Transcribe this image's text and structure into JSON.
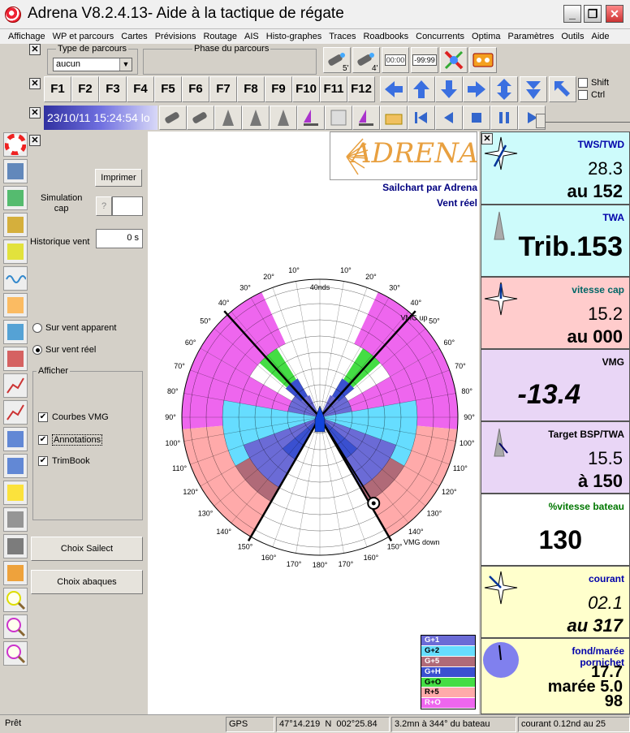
{
  "window": {
    "title": "Adrena V8.2.4.13- Aide à la tactique de régate",
    "minimize": "_",
    "restore": "❐",
    "close": "✕"
  },
  "menu": [
    "Affichage",
    "WP et parcours",
    "Cartes",
    "Prévisions",
    "Routage",
    "AIS",
    "Histo-graphes",
    "Traces",
    "Roadbooks",
    "Concurrents",
    "Optima",
    "Paramètres",
    "Outils",
    "Aide"
  ],
  "toolbar1": {
    "type_parcours_label": "Type de parcours",
    "type_parcours_value": "aucun",
    "phase_label": "Phase du parcours",
    "timer1": "00:00",
    "timer2": "-99:99",
    "btn_5": "5'",
    "btn_4": "4'"
  },
  "toolbar2": {
    "fkeys": [
      "F1",
      "F2",
      "F3",
      "F4",
      "F5",
      "F6",
      "F7",
      "F8",
      "F9",
      "F10",
      "F11",
      "F12"
    ],
    "shift": "Shift",
    "ctrl": "Ctrl"
  },
  "toolbar3": {
    "datetime": "23/10/11 15:24:54 lo"
  },
  "left": {
    "imprimer": "Imprimer",
    "simulation_cap": "Simulation\ncap",
    "question": "?",
    "historique_vent": "Historique vent",
    "historique_value": "0 s",
    "radio1": "Sur vent apparent",
    "radio2": "Sur vent réel",
    "afficher": "Afficher",
    "cb1": "Courbes VMG",
    "cb2": "Annotations",
    "cb3": "TrimBook",
    "choix_sailect": "Choix Sailect",
    "choix_abaques": "Choix abaques",
    "check": "✔"
  },
  "chart": {
    "brand": "ADRENA",
    "subtitle": "Sailchart par Adrena",
    "mode": "Vent réel",
    "center_label": "40nds",
    "vmg_up": "VMG up",
    "vmg_down": "VMG down",
    "angle_labels_left": [
      "10°",
      "20°",
      "30°",
      "40°",
      "50°",
      "60°",
      "70°",
      "80°",
      "90°",
      "100°",
      "110°",
      "120°",
      "130°",
      "140°",
      "150°",
      "160°",
      "170°"
    ],
    "angle_labels_right": [
      "10°",
      "20°",
      "30°",
      "40°",
      "50°",
      "60°",
      "70°",
      "80°",
      "90°",
      "100°",
      "110°",
      "120°",
      "130°",
      "140°",
      "150°",
      "160°",
      "170°"
    ],
    "bottom_label": "180°"
  },
  "legend": [
    {
      "name": "G+1",
      "color": "#6b6bd6"
    },
    {
      "name": "G+2",
      "color": "#66ddff"
    },
    {
      "name": "G+5",
      "color": "#b06a78"
    },
    {
      "name": "G+H",
      "color": "#3a50d0"
    },
    {
      "name": "G+O",
      "color": "#44dd44"
    },
    {
      "name": "R+5",
      "color": "#ffaaaa"
    },
    {
      "name": "R+O",
      "color": "#ee66ee"
    }
  ],
  "cards": [
    {
      "title": "TWS/TWD",
      "v1": "28.3",
      "v2": "au 152",
      "bg": "#cdfbfb",
      "title_color": "#0000aa"
    },
    {
      "title": "TWA",
      "v1": "Trib.153",
      "bg": "#cdfbfb",
      "title_color": "#0000aa"
    },
    {
      "title": "vitesse cap",
      "v1": "15.2",
      "v2": "au 000",
      "bg": "#ffcccc",
      "title_color": "#006666"
    },
    {
      "title": "VMG",
      "v1": "-13.4",
      "bg": "#e9d6f6",
      "title_color": "#000000"
    },
    {
      "title": "Target BSP/TWA",
      "v1": "15.5",
      "v2": "à 150",
      "bg": "#e9d6f6",
      "title_color": "#000000"
    },
    {
      "title": "%vitesse bateau",
      "v1": "130",
      "bg": "#ffffff",
      "title_color": "#007700"
    },
    {
      "title": "courant",
      "v1": "02.1",
      "v2": "au 317",
      "bg": "#ffffcc",
      "title_color": "#0000aa"
    },
    {
      "title": "fond/marée",
      "title2": "pornichet",
      "v1": "17.7",
      "v2": "marée 5.0",
      "v3": "98",
      "bg": "#ffffcc",
      "title_color": "#0000aa"
    }
  ],
  "status": {
    "ready": "Prêt",
    "gps": "GPS",
    "lat": "47°14.219 N",
    "lon": "002°25.84",
    "wp": "3.2mn à 344° du bateau",
    "current": "courant 0.12nd au 25"
  }
}
